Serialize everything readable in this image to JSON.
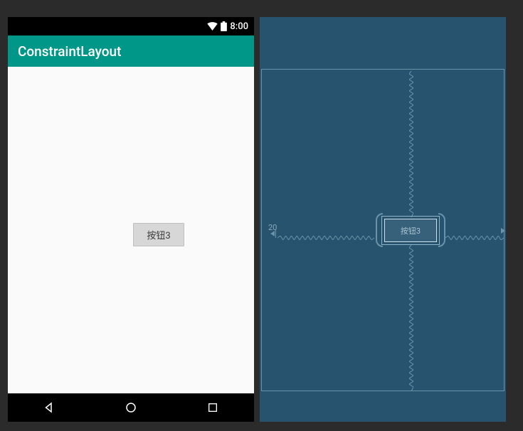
{
  "preview": {
    "status": {
      "time": "8:00"
    },
    "appbar_title": "ConstraintLayout",
    "button3_label": "按钮3"
  },
  "blueprint": {
    "margin_left": "20",
    "widget_label": "按钮3"
  }
}
